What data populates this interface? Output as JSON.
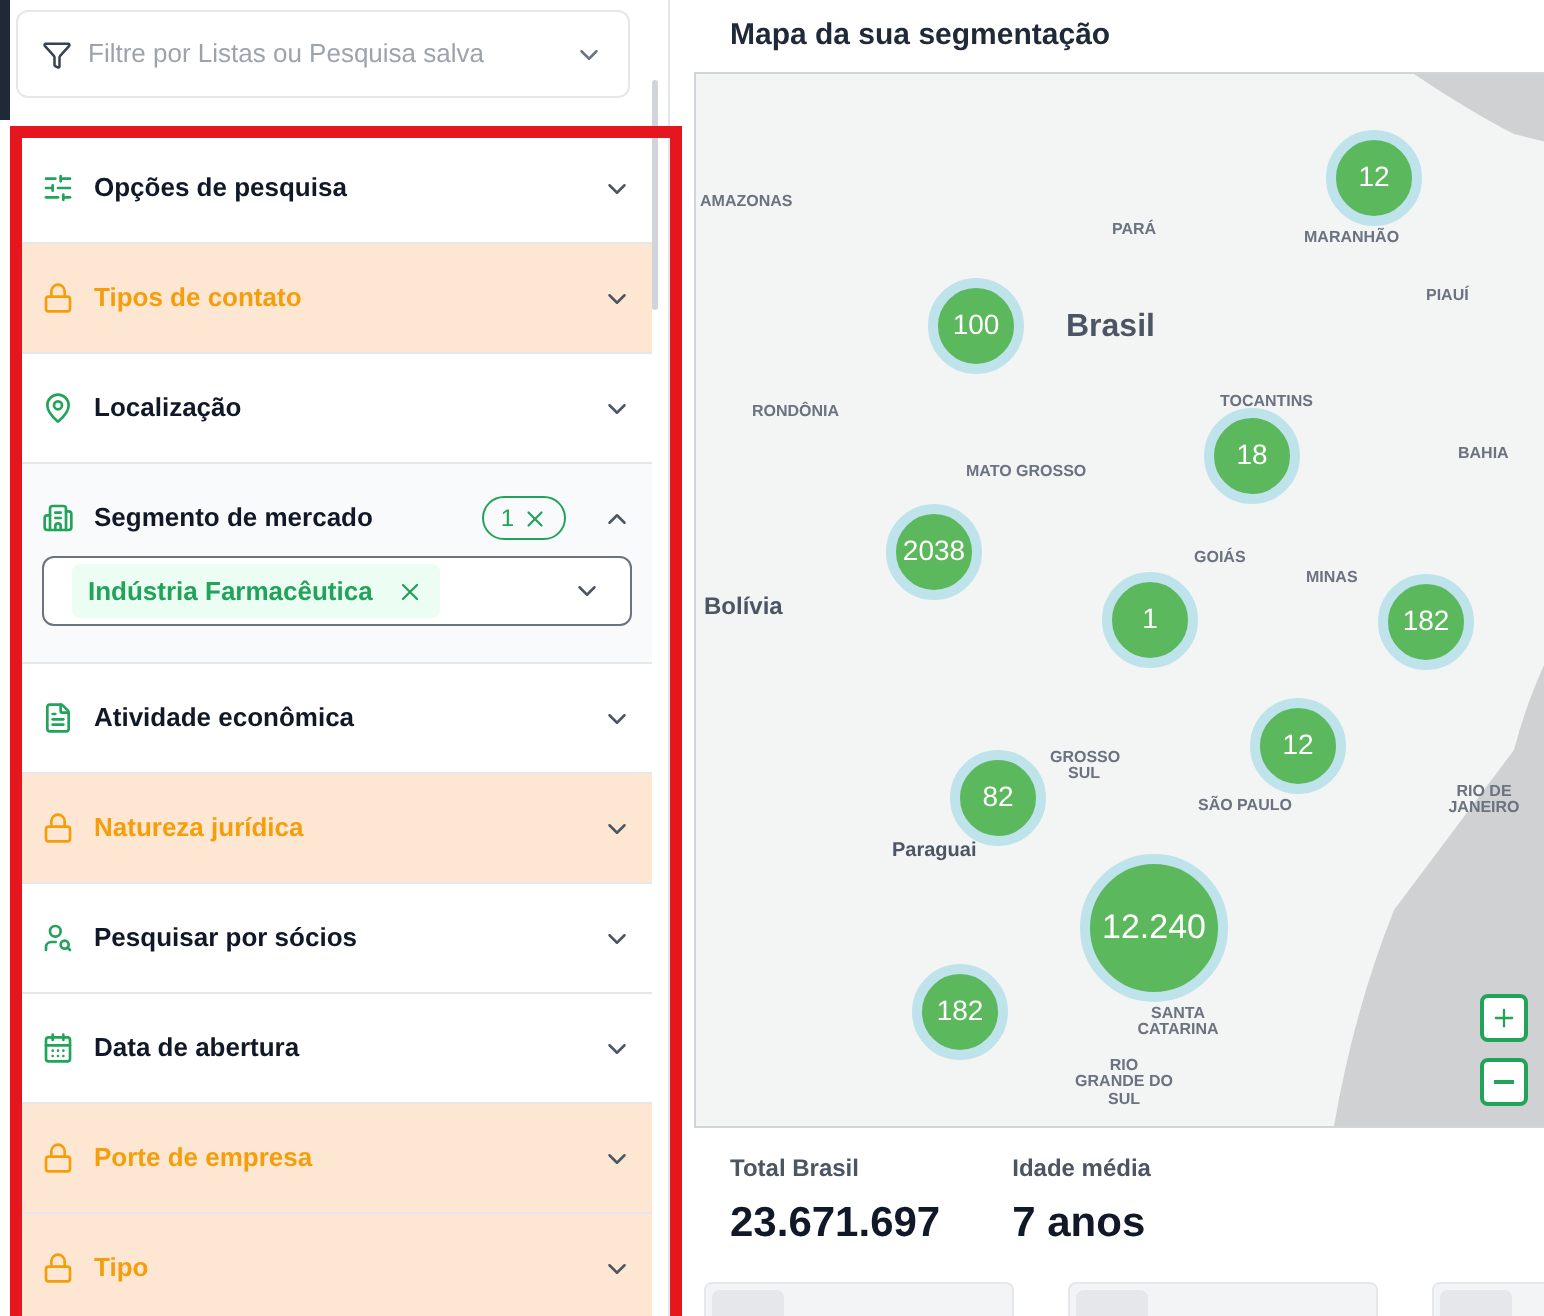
{
  "filter_dropdown": {
    "placeholder": "Filtre por Listas ou Pesquisa salva"
  },
  "sections": [
    {
      "label": "Opções de pesquisa",
      "locked": false,
      "expanded": false
    },
    {
      "label": "Tipos de contato",
      "locked": true,
      "expanded": false
    },
    {
      "label": "Localização",
      "locked": false,
      "expanded": false
    },
    {
      "label": "Segmento de mercado",
      "locked": false,
      "expanded": true,
      "badge": "1",
      "tags": [
        "Indústria Farmacêutica"
      ]
    },
    {
      "label": "Atividade econômica",
      "locked": false,
      "expanded": false
    },
    {
      "label": "Natureza jurídica",
      "locked": true,
      "expanded": false
    },
    {
      "label": "Pesquisar por sócios",
      "locked": false,
      "expanded": false
    },
    {
      "label": "Data de abertura",
      "locked": false,
      "expanded": false
    },
    {
      "label": "Porte de empresa",
      "locked": true,
      "expanded": false
    },
    {
      "label": "Tipo",
      "locked": true,
      "expanded": false
    }
  ],
  "map": {
    "title": "Mapa da sua segmentação",
    "place_labels": [
      "AMAZONAS",
      "PARÁ",
      "MARANHÃO",
      "PIAUÍ",
      "Brasil",
      "RONDÔNIA",
      "TOCANTINS",
      "BAHIA",
      "MATO GROSSO",
      "GOIÁS",
      "Bolívia",
      "MINAS",
      "GROSSO SUL",
      "SÃO PAULO",
      "RIO DE JANEIRO",
      "Paraguai",
      "SANTA CATARINA",
      "RIO GRANDE DO SUL"
    ],
    "clusters": [
      "12",
      "100",
      "18",
      "2038",
      "1",
      "182",
      "12",
      "82",
      "12.240",
      "182"
    ]
  },
  "stats": [
    {
      "label": "Total Brasil",
      "value": "23.671.697"
    },
    {
      "label": "Idade média",
      "value": "7 anos"
    }
  ],
  "cards": [
    {
      "kind": "card"
    },
    {
      "kind": "card"
    },
    {
      "kind": "card"
    }
  ]
}
